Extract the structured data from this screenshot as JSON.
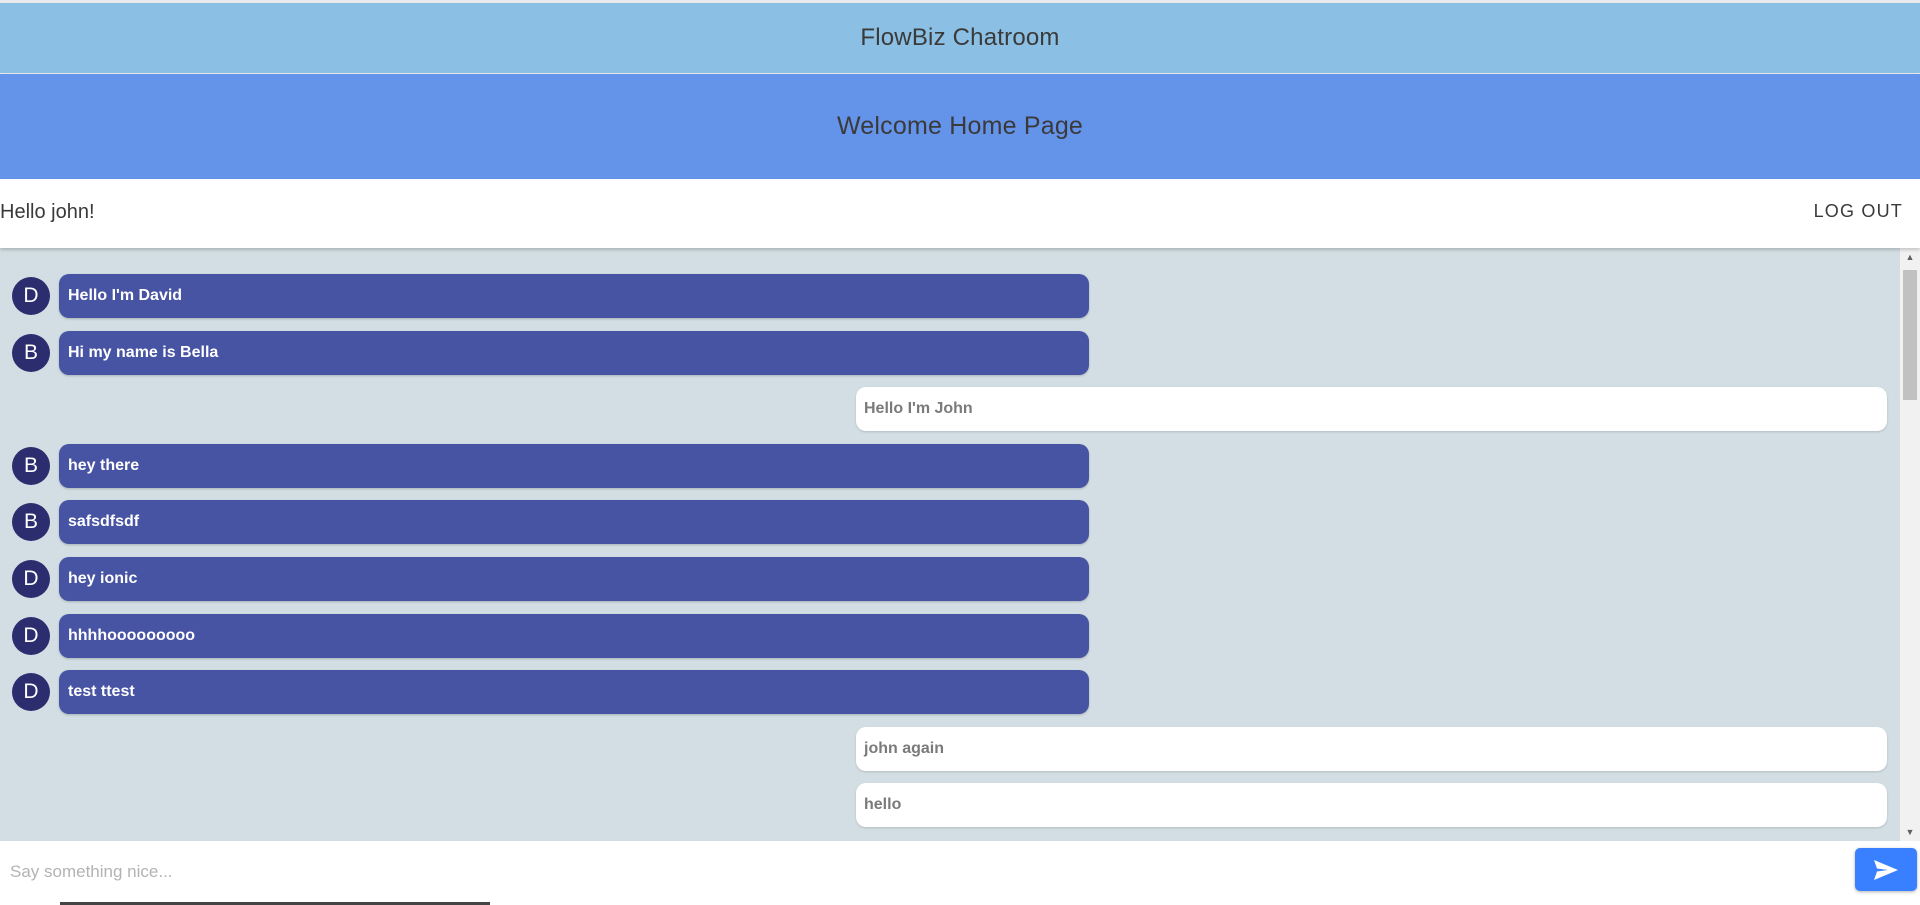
{
  "header": {
    "title": "FlowBiz Chatroom"
  },
  "welcome": {
    "title": "Welcome Home Page"
  },
  "user_bar": {
    "greeting": "Hello john!",
    "logout_label": "LOG OUT"
  },
  "messages": [
    {
      "direction": "in",
      "avatar": "D",
      "text": "Hello I'm David"
    },
    {
      "direction": "in",
      "avatar": "B",
      "text": "Hi my name is Bella"
    },
    {
      "direction": "out",
      "text": "Hello I'm John"
    },
    {
      "direction": "in",
      "avatar": "B",
      "text": "hey there"
    },
    {
      "direction": "in",
      "avatar": "B",
      "text": "safsdfsdf"
    },
    {
      "direction": "in",
      "avatar": "D",
      "text": "hey ionic"
    },
    {
      "direction": "in",
      "avatar": "D",
      "text": "hhhhooooooooo"
    },
    {
      "direction": "in",
      "avatar": "D",
      "text": "test ttest"
    },
    {
      "direction": "out",
      "text": "john again"
    },
    {
      "direction": "out",
      "text": "hello"
    }
  ],
  "composer": {
    "placeholder": "Say something nice...",
    "value": "",
    "send_icon": "send-icon"
  },
  "colors": {
    "header_bg": "#8bc0e4",
    "welcome_bg": "#6493ea",
    "chat_bg": "#d2dee3",
    "incoming_bubble": "#4753a3",
    "avatar_bg": "#2b2d6e",
    "outgoing_bubble": "#ffffff",
    "send_button": "#3880ff"
  }
}
